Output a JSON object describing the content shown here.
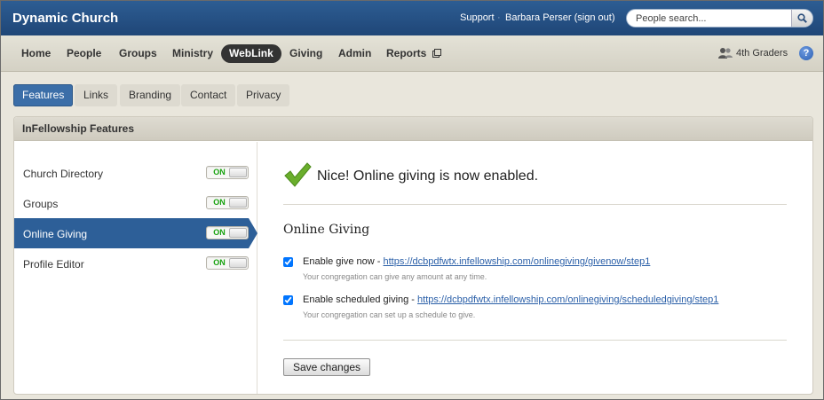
{
  "app": {
    "brand": "Dynamic Church"
  },
  "top": {
    "support": "Support",
    "separator": "·",
    "user": "Barbara Perser (sign out)",
    "search_placeholder": "People search...",
    "search_icon": "magnifier-icon"
  },
  "nav": {
    "items": [
      "Home",
      "People",
      "Groups",
      "Ministry",
      "WebLink",
      "Giving",
      "Admin",
      "Reports"
    ],
    "active": "WebLink",
    "external_icon": "external-window-icon",
    "group_label": "4th Graders",
    "group_icon": "people-icon",
    "help": "?"
  },
  "subtabs": {
    "items": [
      "Features",
      "Links",
      "Branding",
      "Contact",
      "Privacy"
    ],
    "active": "Features"
  },
  "panel": {
    "title": "InFellowship Features",
    "features": [
      {
        "label": "Church Directory",
        "state": "ON"
      },
      {
        "label": "Groups",
        "state": "ON"
      },
      {
        "label": "Online Giving",
        "state": "ON"
      },
      {
        "label": "Profile Editor",
        "state": "ON"
      }
    ],
    "active_feature": "Online Giving"
  },
  "main": {
    "success_message": "Nice! Online giving is now enabled.",
    "section_title": "Online Giving",
    "options": [
      {
        "label": "Enable give now - ",
        "link": "https://dcbpdfwtx.infellowship.com/onlinegiving/givenow/step1",
        "help": "Your congregation can give any amount at any time.",
        "checked": true
      },
      {
        "label": "Enable scheduled giving - ",
        "link": "https://dcbpdfwtx.infellowship.com/onlinegiving/scheduledgiving/step1",
        "help": "Your congregation can set up a schedule to give.",
        "checked": true
      }
    ],
    "save_label": "Save changes"
  },
  "colors": {
    "top_bar": "#1f4677",
    "accent": "#2d5f98",
    "toggle_on": "#17a20f",
    "link": "#2a5fa8"
  }
}
